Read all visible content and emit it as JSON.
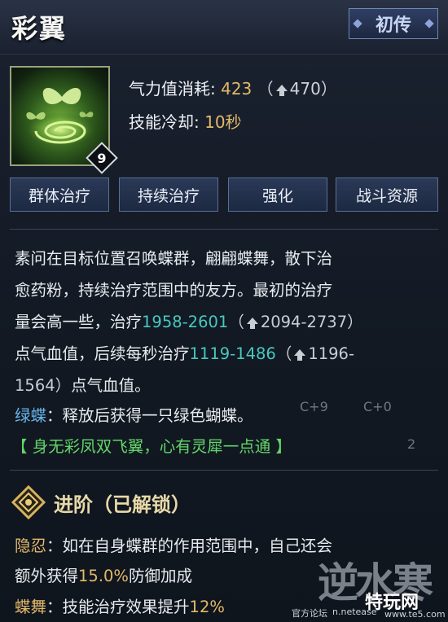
{
  "skill": {
    "name": "彩翼",
    "rank": "初传",
    "level": "9",
    "icon": "butterfly-swirl-skill-icon"
  },
  "stats": {
    "cost_label": "气力值消耗:",
    "cost_value": "423",
    "cost_upgrade": "470",
    "cooldown_label": "技能冷却:",
    "cooldown_value": "10秒"
  },
  "tags": [
    "群体治疗",
    "持续治疗",
    "强化",
    "战斗资源"
  ],
  "description": {
    "line1": "素问在目标位置召唤蝶群，翩翩蝶舞，散下治",
    "line2": "愈药粉，持续治疗范围中的友方。最初的治疗",
    "line3_a": "量会高一些，治疗",
    "line3_range": "1958-2601",
    "line3_up": "2094-2737",
    "line4_a": "点气血值，后续每秒治疗",
    "line4_range": "1119-1486",
    "line4_up": "1196-",
    "line5_up": "1564",
    "line5_b": "点气血值。",
    "green_label": "绿蝶",
    "green_text": "：释放后获得一只绿色蝴蝶。",
    "quote": "【 身无彩凤双飞翼，心有灵犀一点通 】"
  },
  "advance": {
    "title": "进阶（已解锁）",
    "item1_label": "隐忍",
    "item1_text": "：如在自身蝶群的作用范围中，自己还会",
    "item1_line2_a": "额外获得",
    "item1_pct": "15.0%",
    "item1_line2_b": "防御加成",
    "item2_label": "蝶舞",
    "item2_text": "：技能治疗效果提升",
    "item2_pct": "12%"
  },
  "background_text": {
    "c9": "C+9",
    "c0": "C+0",
    "count": "2"
  },
  "watermark": {
    "mark": "逆水寒",
    "forum": "官方论坛",
    "domain": "n.netease",
    "brand": "特玩网",
    "site": "www.te5.com"
  },
  "colors": {
    "accent_gold": "#e2b86a",
    "heal_teal": "#49c8c0",
    "label_blue": "#68b3e8",
    "quote_green": "#63d66a"
  }
}
